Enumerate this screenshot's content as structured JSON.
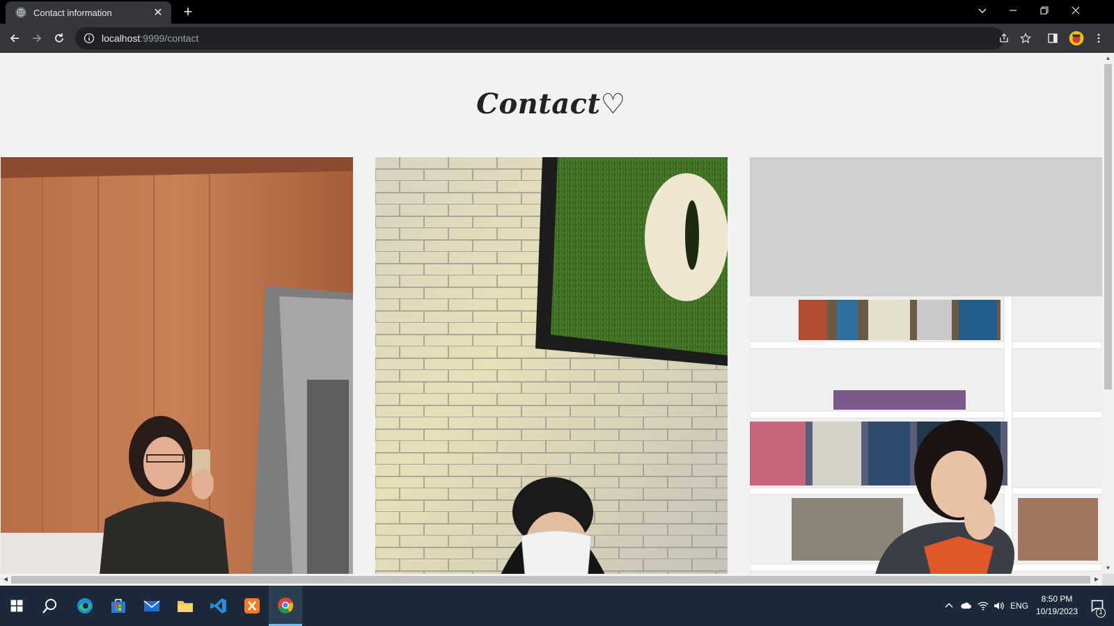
{
  "browser": {
    "tab_title": "Contact information",
    "close_glyph": "✕",
    "new_tab_glyph": "+",
    "url_host": "localhost",
    "url_path": ":9999/contact"
  },
  "page": {
    "heading": "Contact♡",
    "photos": [
      {
        "icon": "photo-person-mirror-selfie"
      },
      {
        "icon": "photo-person-brick-wall"
      },
      {
        "icon": "photo-person-bookshelf"
      }
    ]
  },
  "taskbar": {
    "language": "ENG",
    "time": "8:50 PM",
    "date": "10/19/2023",
    "notification_count": "1"
  },
  "colors": {
    "page_background": "#f2f2f2",
    "tab_strip": "#000000",
    "toolbar": "#35363a",
    "taskbar": "#1b2a3a"
  }
}
